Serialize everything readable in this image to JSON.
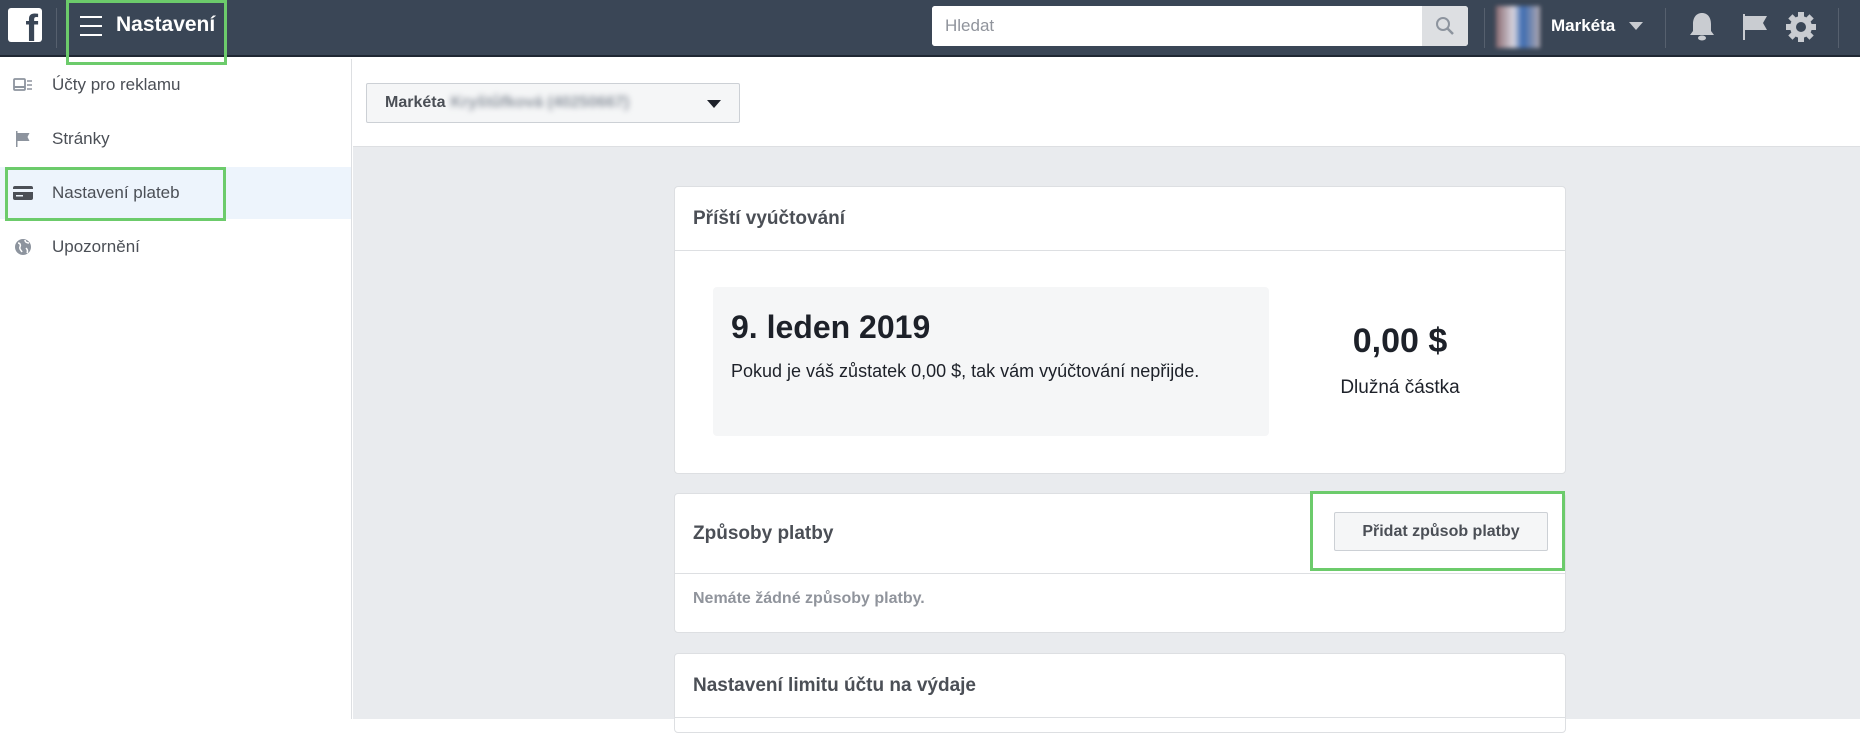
{
  "topbar": {
    "logo": "f",
    "section_title": "Nastavení",
    "search_placeholder": "Hledat",
    "user_name": "Markéta"
  },
  "sidebar": {
    "items": [
      {
        "label": "Účty pro reklamu",
        "icon": "ad-account-icon"
      },
      {
        "label": "Stránky",
        "icon": "flag-icon"
      },
      {
        "label": "Nastavení plateb",
        "icon": "credit-card-icon",
        "active": true
      },
      {
        "label": "Upozornění",
        "icon": "globe-icon"
      }
    ]
  },
  "account_selector": {
    "first_name": "Markéta",
    "blurred_rest": "Kryštůfková (40250667)"
  },
  "next_billing": {
    "title": "Příští vyúčtování",
    "date": "9. leden 2019",
    "description": "Pokud je váš zůstatek 0,00 $, tak vám vyúčtování nepřijde.",
    "amount": "0,00 $",
    "amount_label": "Dlužná částka"
  },
  "payment_methods": {
    "title": "Způsoby platby",
    "add_button": "Přidat způsob platby",
    "empty_text": "Nemáte žádné způsoby platby."
  },
  "spending_limit": {
    "title": "Nastavení limitu účtu na výdaje"
  },
  "colors": {
    "topbar": "#3a4656",
    "highlight": "#6ccb6b",
    "active_bg": "#edf4fc"
  }
}
